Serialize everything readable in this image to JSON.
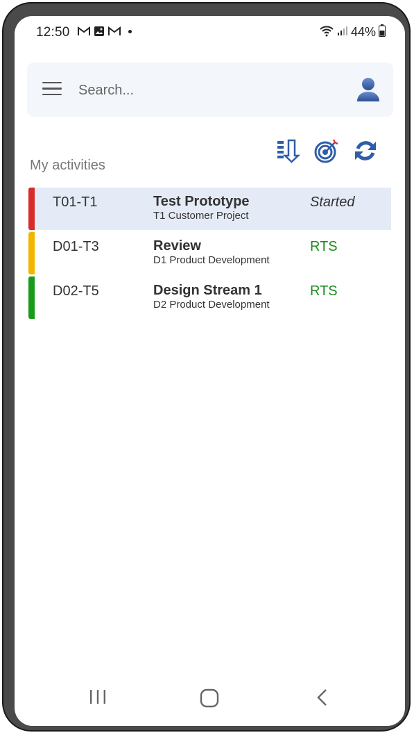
{
  "status_bar": {
    "time": "12:50",
    "battery": "44%",
    "notification_icons": [
      "gmail-icon",
      "gallery-icon",
      "gmail-icon"
    ]
  },
  "search": {
    "placeholder": "Search..."
  },
  "section": {
    "title": "My activities"
  },
  "toolbar": {
    "buttons": [
      {
        "name": "sort-icon"
      },
      {
        "name": "target-icon"
      },
      {
        "name": "refresh-icon"
      }
    ]
  },
  "activities": [
    {
      "code": "T01-T1",
      "title": "Test Prototype",
      "subtitle": "T1 Customer Project",
      "status": "Started",
      "color": "#d82b2b",
      "status_color": "#333333",
      "status_style": "italic",
      "selected": true
    },
    {
      "code": "D01-T3",
      "title": "Review",
      "subtitle": "D1 Product Development",
      "status": "RTS",
      "color": "#f2b600",
      "status_color": "#1e8c1e",
      "status_style": "normal",
      "selected": false
    },
    {
      "code": "D02-T5",
      "title": "Design Stream 1",
      "subtitle": "D2  Product Development",
      "status": "RTS",
      "color": "#1a9a1a",
      "status_color": "#1e8c1e",
      "status_style": "normal",
      "selected": false
    }
  ],
  "colors": {
    "accent": "#2f5ea8",
    "frame": "#4a4a4a"
  }
}
